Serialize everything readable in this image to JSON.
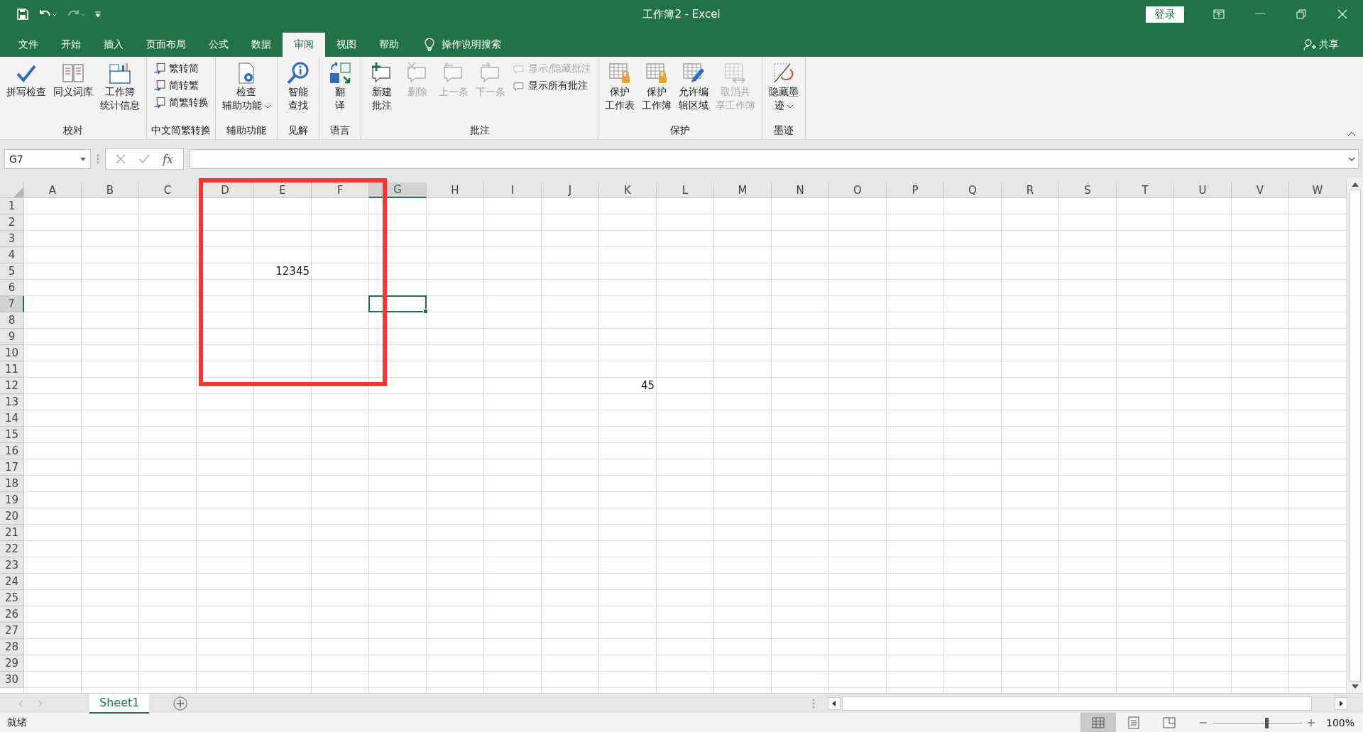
{
  "window": {
    "title": "工作簿2  -  Excel",
    "login": "登录",
    "share": "共享"
  },
  "tabs": [
    {
      "label": "文件",
      "selected": false
    },
    {
      "label": "开始",
      "selected": false
    },
    {
      "label": "插入",
      "selected": false
    },
    {
      "label": "页面布局",
      "selected": false
    },
    {
      "label": "公式",
      "selected": false
    },
    {
      "label": "数据",
      "selected": false
    },
    {
      "label": "审阅",
      "selected": true
    },
    {
      "label": "视图",
      "selected": false
    },
    {
      "label": "帮助",
      "selected": false
    }
  ],
  "search": {
    "placeholder": "操作说明搜索"
  },
  "ribbon": {
    "groups": [
      {
        "label": "校对",
        "commands": [
          {
            "kind": "large",
            "lines": [
              "拼写检查"
            ],
            "disabled": false,
            "dropdown": false
          },
          {
            "kind": "large",
            "lines": [
              "同义词库"
            ],
            "disabled": false,
            "dropdown": false
          },
          {
            "kind": "large",
            "lines": [
              "工作簿",
              "统计信息"
            ],
            "disabled": false,
            "dropdown": false
          }
        ]
      },
      {
        "label": "中文简繁转换",
        "commands": [
          {
            "kind": "small",
            "lines": [
              "繁转简"
            ],
            "disabled": false
          },
          {
            "kind": "small",
            "lines": [
              "简转繁"
            ],
            "disabled": false
          },
          {
            "kind": "small",
            "lines": [
              "简繁转换"
            ],
            "disabled": false
          }
        ]
      },
      {
        "label": "辅助功能",
        "commands": [
          {
            "kind": "large",
            "lines": [
              "检查",
              "辅助功能"
            ],
            "disabled": false,
            "dropdown": true
          }
        ]
      },
      {
        "label": "见解",
        "commands": [
          {
            "kind": "large",
            "lines": [
              "智能",
              "查找"
            ],
            "disabled": false,
            "dropdown": false
          }
        ]
      },
      {
        "label": "语言",
        "commands": [
          {
            "kind": "large",
            "lines": [
              "翻",
              "译"
            ],
            "disabled": false,
            "dropdown": false
          }
        ]
      },
      {
        "label": "批注",
        "commands": [
          {
            "kind": "large",
            "lines": [
              "新建",
              "批注"
            ],
            "disabled": false,
            "dropdown": false
          },
          {
            "kind": "large",
            "lines": [
              "删除"
            ],
            "disabled": true,
            "dropdown": false
          },
          {
            "kind": "large",
            "lines": [
              "上一条"
            ],
            "disabled": true,
            "dropdown": false
          },
          {
            "kind": "large",
            "lines": [
              "下一条"
            ],
            "disabled": true,
            "dropdown": false
          },
          {
            "kind": "small",
            "lines": [
              "显示/隐藏批注"
            ],
            "disabled": true
          },
          {
            "kind": "small",
            "lines": [
              "显示所有批注"
            ],
            "disabled": false
          }
        ]
      },
      {
        "label": "保护",
        "commands": [
          {
            "kind": "large",
            "lines": [
              "保护",
              "工作表"
            ],
            "disabled": false,
            "dropdown": false
          },
          {
            "kind": "large",
            "lines": [
              "保护",
              "工作簿"
            ],
            "disabled": false,
            "dropdown": false
          },
          {
            "kind": "large",
            "lines": [
              "允许编",
              "辑区域"
            ],
            "disabled": false,
            "dropdown": false
          },
          {
            "kind": "large",
            "lines": [
              "取消共",
              "享工作簿"
            ],
            "disabled": true,
            "dropdown": false
          }
        ]
      },
      {
        "label": "墨迹",
        "commands": [
          {
            "kind": "large",
            "lines": [
              "隐藏墨",
              "迹"
            ],
            "disabled": false,
            "dropdown": true
          }
        ]
      }
    ]
  },
  "formula_bar": {
    "name_box": "G7",
    "function_button": "fx"
  },
  "columns": [
    {
      "label": "A",
      "selected": false
    },
    {
      "label": "B",
      "selected": false
    },
    {
      "label": "C",
      "selected": false
    },
    {
      "label": "D",
      "selected": false
    },
    {
      "label": "E",
      "selected": false
    },
    {
      "label": "F",
      "selected": false
    },
    {
      "label": "G",
      "selected": true
    },
    {
      "label": "H",
      "selected": false
    },
    {
      "label": "I",
      "selected": false
    },
    {
      "label": "J",
      "selected": false
    },
    {
      "label": "K",
      "selected": false
    },
    {
      "label": "L",
      "selected": false
    },
    {
      "label": "M",
      "selected": false
    },
    {
      "label": "N",
      "selected": false
    },
    {
      "label": "O",
      "selected": false
    },
    {
      "label": "P",
      "selected": false
    },
    {
      "label": "Q",
      "selected": false
    },
    {
      "label": "R",
      "selected": false
    },
    {
      "label": "S",
      "selected": false
    },
    {
      "label": "T",
      "selected": false
    },
    {
      "label": "U",
      "selected": false
    },
    {
      "label": "V",
      "selected": false
    },
    {
      "label": "W",
      "selected": false
    }
  ],
  "rows": [
    {
      "label": "1",
      "selected": false
    },
    {
      "label": "2",
      "selected": false
    },
    {
      "label": "3",
      "selected": false
    },
    {
      "label": "4",
      "selected": false
    },
    {
      "label": "5",
      "selected": false,
      "cells": [
        {
          "kind": "empty"
        },
        {
          "kind": "empty"
        },
        {
          "kind": "empty"
        },
        {
          "kind": "empty"
        },
        {
          "kind": "number",
          "value": "12345"
        }
      ]
    },
    {
      "label": "6",
      "selected": false
    },
    {
      "label": "7",
      "selected": true
    },
    {
      "label": "8",
      "selected": false
    },
    {
      "label": "9",
      "selected": false
    },
    {
      "label": "10",
      "selected": false
    },
    {
      "label": "11",
      "selected": false
    },
    {
      "label": "12",
      "selected": false,
      "cells": [
        {
          "kind": "empty"
        },
        {
          "kind": "empty"
        },
        {
          "kind": "empty"
        },
        {
          "kind": "empty"
        },
        {
          "kind": "empty"
        },
        {
          "kind": "empty"
        },
        {
          "kind": "empty"
        },
        {
          "kind": "empty"
        },
        {
          "kind": "empty"
        },
        {
          "kind": "empty"
        },
        {
          "kind": "number",
          "value": "45"
        }
      ]
    },
    {
      "label": "13",
      "selected": false
    },
    {
      "label": "14",
      "selected": false
    },
    {
      "label": "15",
      "selected": false
    },
    {
      "label": "16",
      "selected": false
    },
    {
      "label": "17",
      "selected": false
    },
    {
      "label": "18",
      "selected": false
    },
    {
      "label": "19",
      "selected": false
    },
    {
      "label": "20",
      "selected": false
    },
    {
      "label": "21",
      "selected": false
    },
    {
      "label": "22",
      "selected": false
    },
    {
      "label": "23",
      "selected": false
    },
    {
      "label": "24",
      "selected": false
    },
    {
      "label": "25",
      "selected": false
    },
    {
      "label": "26",
      "selected": false
    },
    {
      "label": "27",
      "selected": false
    },
    {
      "label": "28",
      "selected": false
    },
    {
      "label": "29",
      "selected": false
    },
    {
      "label": "30",
      "selected": false
    }
  ],
  "highlight_box": {
    "kind": "rectangle"
  },
  "sheet_tabs": [
    {
      "label": "Sheet1",
      "selected": true
    }
  ],
  "status_bar": {
    "text": "就绪",
    "views": [
      {
        "selected": true
      },
      {
        "selected": false
      },
      {
        "selected": false
      }
    ],
    "level": 0.6,
    "zoom": "100%"
  }
}
